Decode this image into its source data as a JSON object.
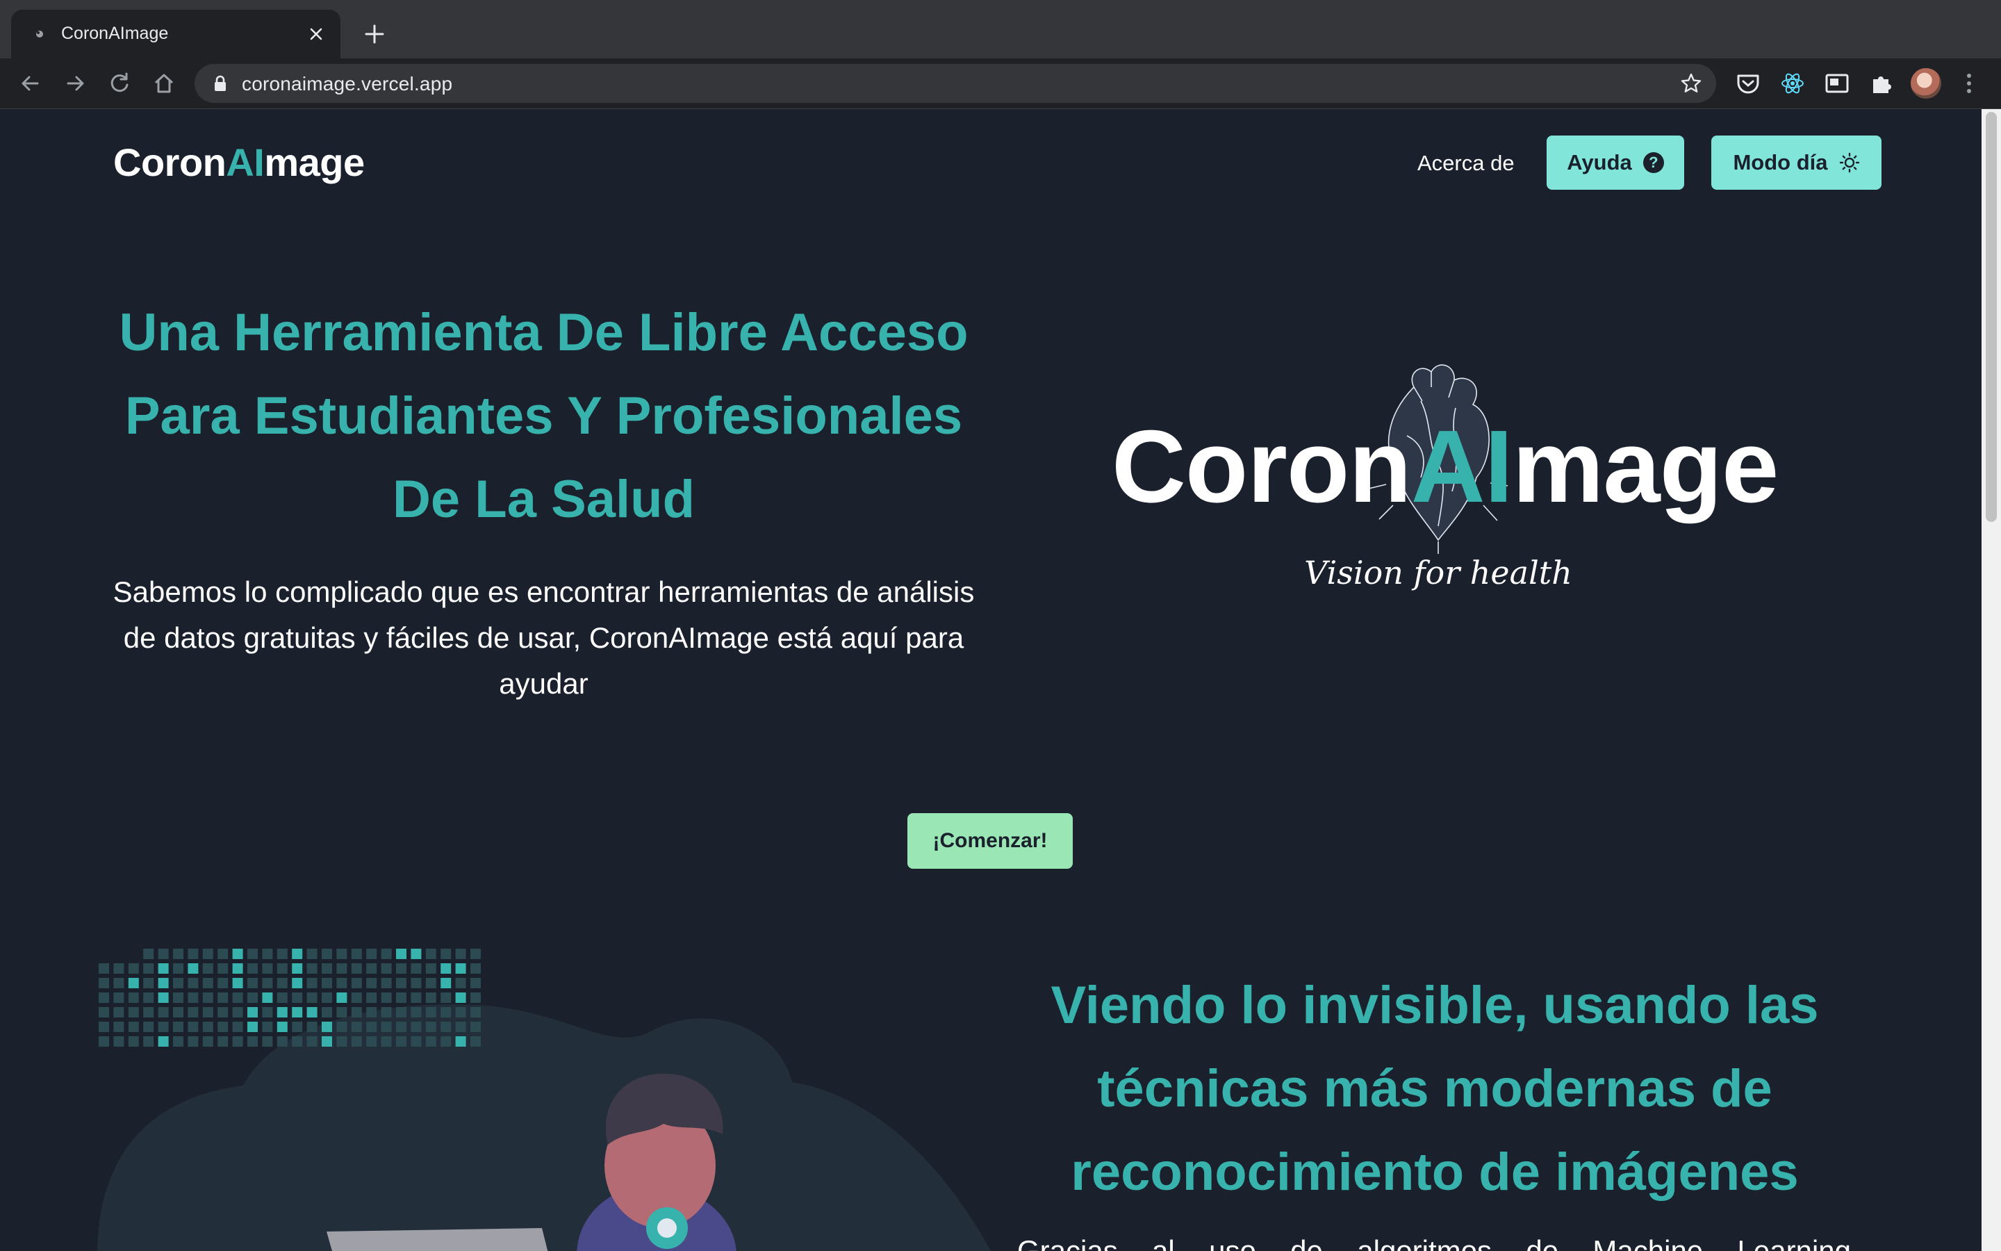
{
  "browser": {
    "tab_title": "CoronAImage",
    "url": "coronaimage.vercel.app"
  },
  "header": {
    "brand_prefix": "Coron",
    "brand_ai": "AI",
    "brand_suffix": "mage",
    "nav_about": "Acerca de",
    "help_label": "Ayuda",
    "help_icon_glyph": "?",
    "mode_label": "Modo día"
  },
  "hero": {
    "title": "Una Herramienta De Libre Acceso Para Estudiantes Y Profesionales De La Salud",
    "description": "Sabemos lo complicado que es encontrar herramientas de análisis de datos gratuitas y fáciles de usar, CoronAImage está aquí para ayudar",
    "logo_prefix": "Coron",
    "logo_ai": "AI",
    "logo_suffix": "mage",
    "logo_tagline": "Vision for health"
  },
  "cta": {
    "label": "¡Comenzar!"
  },
  "section": {
    "title": "Viendo lo invisible, usando las técnicas más modernas de reconocimiento de imágenes",
    "text": "Gracias al uso de algoritmos de Machine Learning"
  },
  "icons": {
    "favicon": "page-favicon",
    "help": "question-circle-icon",
    "mode": "sun-icon"
  },
  "colors": {
    "background": "#1a202c",
    "accent": "#38b2ac",
    "button": "#81e6d9",
    "cta": "#9ae6b4"
  }
}
